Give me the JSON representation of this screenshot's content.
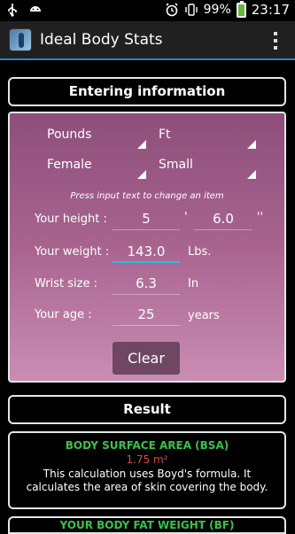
{
  "status_bar": {
    "battery_percent": "99%",
    "time": "23:17",
    "icons": [
      "usb-icon",
      "android-icon",
      "alarm-icon",
      "vibrate-icon",
      "battery-icon"
    ]
  },
  "action_bar": {
    "title": "Ideal Body Stats",
    "overflow_icon": "overflow-menu-icon"
  },
  "entering": {
    "header": "Entering information",
    "weight_unit_spinner": "Pounds",
    "height_unit_spinner": "Ft",
    "gender_spinner": "Female",
    "frame_spinner": "Small",
    "hint": "Press input text to change an item",
    "height": {
      "label": "Your height :",
      "feet": "5",
      "feet_sep": "'",
      "inches": "6.0",
      "inches_sep": "''"
    },
    "weight": {
      "label": "Your weight :",
      "value": "143.0",
      "unit": "Lbs."
    },
    "wrist": {
      "label": "Wrist size :",
      "value": "6.3",
      "unit": "In"
    },
    "age": {
      "label": "Your age :",
      "value": "25",
      "unit": "years"
    },
    "clear_label": "Clear"
  },
  "result": {
    "header": "Result",
    "bsa": {
      "title": "BODY SURFACE AREA (BSA)",
      "value": "1.75 m²",
      "description": "This calculation uses Boyd's formula. It calculates the area of skin covering the body."
    },
    "next_title": "YOUR BODY FAT WEIGHT (BF)"
  },
  "colors": {
    "accent": "#1f8bbd",
    "panel_top": "#8d4f7a",
    "panel_bottom": "#c98db3",
    "result_title": "#35c449",
    "result_value": "#e04545"
  }
}
